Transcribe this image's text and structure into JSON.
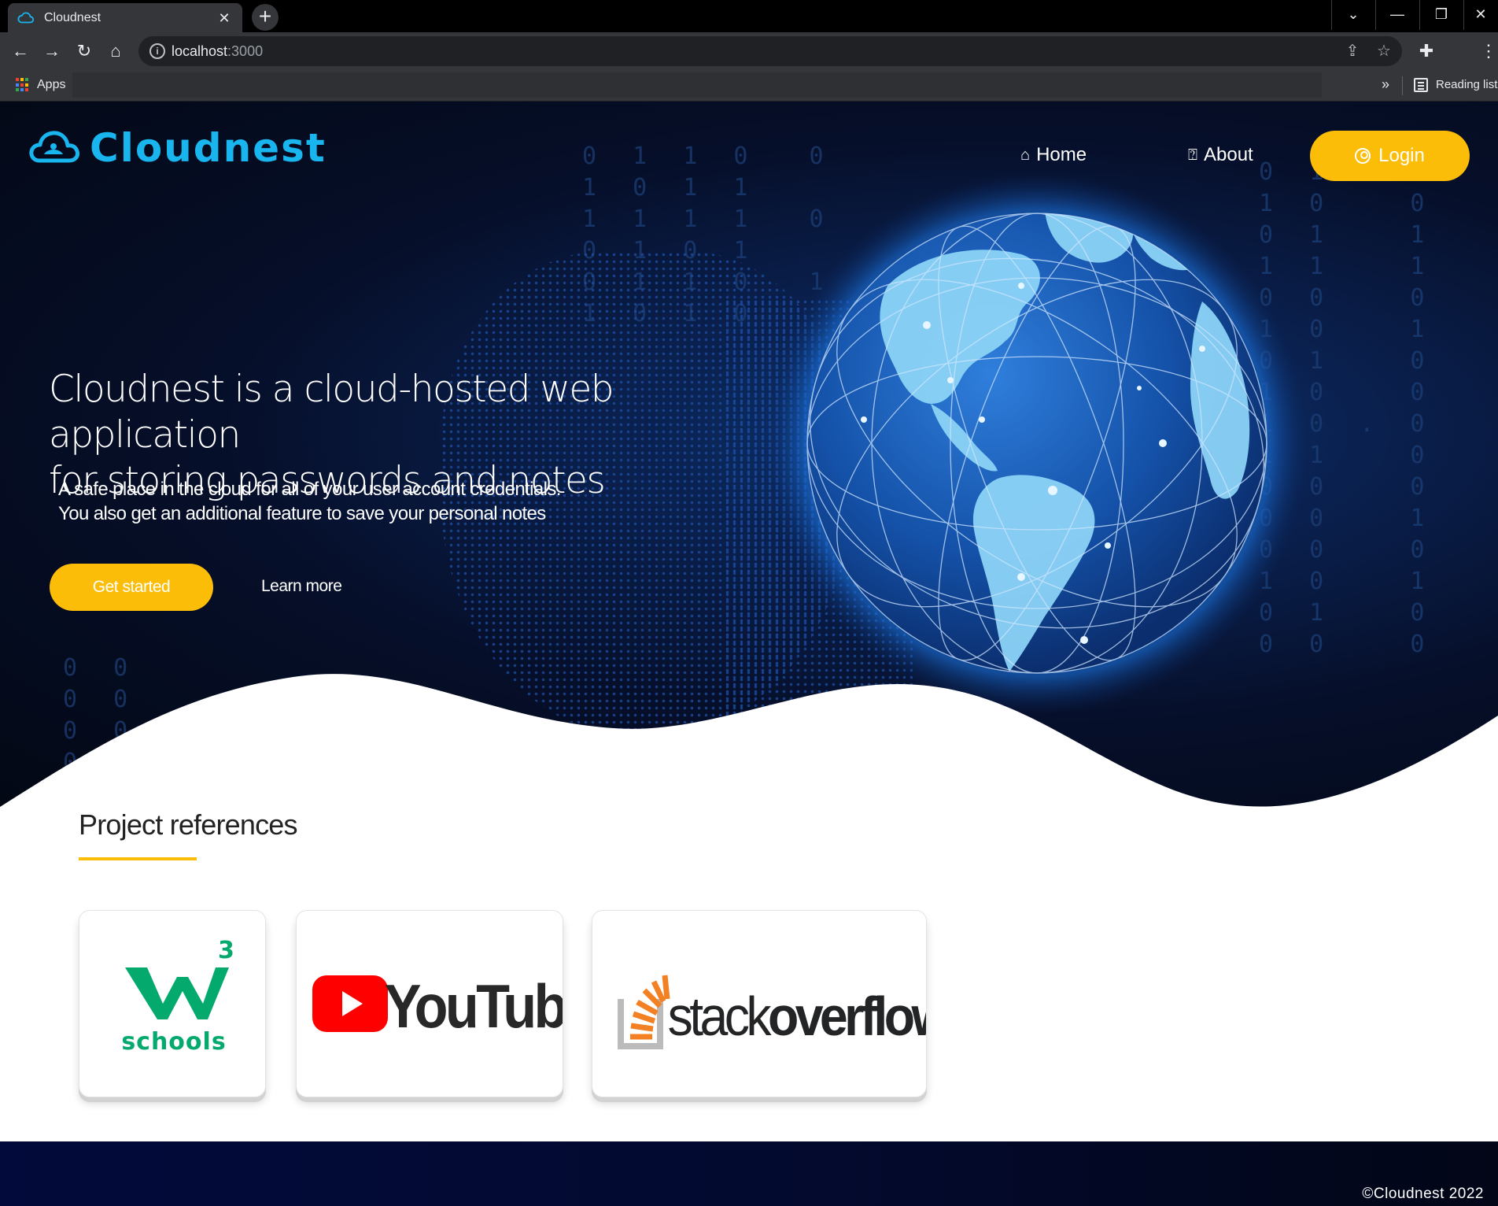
{
  "browser": {
    "tab_title": "Cloudnest",
    "url_host": "localhost",
    "url_port": ":3000",
    "apps_label": "Apps",
    "more_bookmarks": "»",
    "reading_list_label": "Reading list"
  },
  "site": {
    "brand": "Cloudnest",
    "nav": {
      "home_label": "Home",
      "about_label": "About",
      "login_label": "Login"
    },
    "hero": {
      "headline_line1": "Cloudnest is a cloud-hosted web application",
      "headline_line2": "for storing passwords and notes",
      "sub_line1": "A safe place in the cloud for all of your user account credentials.",
      "sub_line2": "You also get an additional feature to save your personal notes",
      "cta_primary": "Get started",
      "cta_secondary": "Learn more"
    },
    "references": {
      "title": "Project references",
      "items": [
        {
          "name": "w3schools",
          "logo_text": "schools",
          "superscript": "3"
        },
        {
          "name": "YouTube",
          "logo_text": "YouTube"
        },
        {
          "name": "stackoverflow",
          "logo_text_light": "stack",
          "logo_text_bold": "overflow"
        }
      ]
    },
    "footer": "©Cloudnest 2022"
  },
  "colors": {
    "accent": "#fbbd08",
    "brand": "#19b5ef",
    "hero_bg": "#050d24",
    "footer_bg": "#020a3b",
    "w3_green": "#04aa6d",
    "youtube_red": "#ff0000",
    "so_orange": "#f48024"
  }
}
